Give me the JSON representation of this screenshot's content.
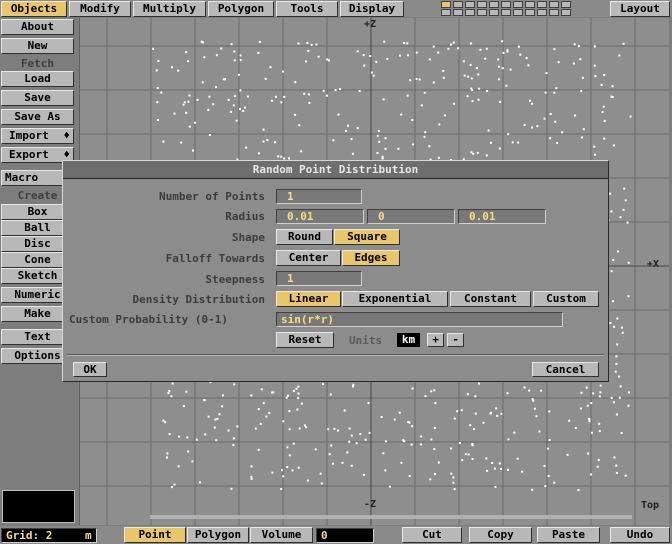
{
  "tabs": [
    {
      "label": "Objects",
      "selected": true
    },
    {
      "label": "Modify",
      "selected": false
    },
    {
      "label": "Multiply",
      "selected": false
    },
    {
      "label": "Polygon",
      "selected": false
    },
    {
      "label": "Tools",
      "selected": false
    },
    {
      "label": "Display",
      "selected": false
    }
  ],
  "layout_button": "Layout",
  "left_panel": {
    "about": "About",
    "new": "New",
    "fetch": "Fetch",
    "load": "Load",
    "save": "Save",
    "save_as": "Save As",
    "import": "Import",
    "export": "Export",
    "macro": "Macro",
    "create": "Create",
    "box": "Box",
    "ball": "Ball",
    "disc": "Disc",
    "cone": "Cone",
    "sketch": "Sketch",
    "numeric": "Numeric",
    "make": "Make",
    "text": "Text",
    "options": "Options",
    "import_arrow": "♦",
    "export_arrow": "♦"
  },
  "viewport": {
    "plus_z": "+Z",
    "minus_z": "-Z",
    "plus_x": "+X",
    "view_label": "Top"
  },
  "dialog": {
    "title": "Random Point Distribution",
    "number_of_points_label": "Number of Points",
    "number_of_points": "1",
    "radius_label": "Radius",
    "radius_x": "0.01",
    "radius_y": "0",
    "radius_z": "0.01",
    "shape_label": "Shape",
    "shape_round": "Round",
    "shape_square": "Square",
    "falloff_label": "Falloff Towards",
    "falloff_center": "Center",
    "falloff_edges": "Edges",
    "steepness_label": "Steepness",
    "steepness": "1",
    "density_label": "Density Distribution",
    "density_linear": "Linear",
    "density_exponential": "Exponential",
    "density_constant": "Constant",
    "density_custom": "Custom",
    "custom_prob_label": "Custom Probability (0-1)",
    "custom_prob": "sin(r*r)",
    "reset": "Reset",
    "units_label": "Units",
    "units_value": "km",
    "units_plus": "+",
    "units_minus": "-",
    "ok": "OK",
    "cancel": "Cancel"
  },
  "bottom": {
    "grid_label": "Grid:",
    "grid_value": "2",
    "grid_unit": "m",
    "mode_point": "Point",
    "mode_polygon": "Polygon",
    "mode_volume": "Volume",
    "count": "0",
    "cut": "Cut",
    "copy": "Copy",
    "paste": "Paste",
    "undo": "Undo"
  },
  "colors": {
    "selected": "#e9c66a",
    "field_text": "#f0e080",
    "viewport_bg": "#8e8e8e",
    "grid_line": "#6a6a6a",
    "point": "#ffffff"
  }
}
